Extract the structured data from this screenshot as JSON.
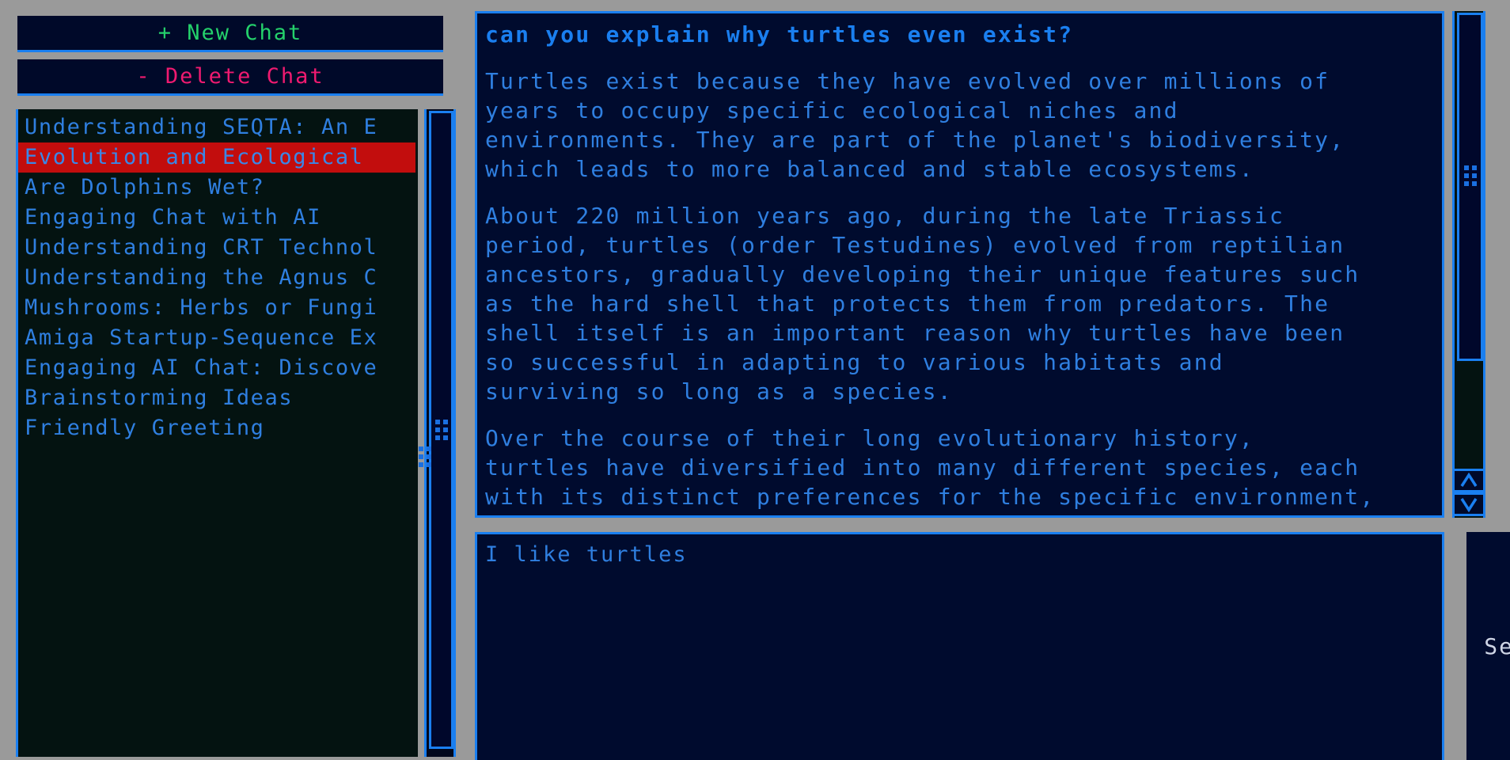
{
  "sidebar": {
    "new_chat_label": "+ New Chat",
    "delete_chat_label": "- Delete Chat",
    "chats": [
      {
        "title": "Understanding SEQTA: An E"
      },
      {
        "title": "Evolution and Ecological"
      },
      {
        "title": "Are Dolphins Wet?"
      },
      {
        "title": "Engaging Chat with AI"
      },
      {
        "title": "Understanding CRT Technol"
      },
      {
        "title": "Understanding the Agnus C"
      },
      {
        "title": "Mushrooms: Herbs or Fungi"
      },
      {
        "title": "Amiga Startup-Sequence Ex"
      },
      {
        "title": "Engaging AI Chat: Discove"
      },
      {
        "title": "Brainstorming Ideas"
      },
      {
        "title": "Friendly Greeting"
      }
    ],
    "selected_index": 1
  },
  "transcript": {
    "messages": [
      {
        "role": "user",
        "text": "can you explain why turtles even exist?"
      },
      {
        "role": "assistant",
        "text": "Turtles exist because they have evolved over millions of\nyears to occupy specific ecological niches and\nenvironments. They are part of the planet's biodiversity,\nwhich leads to more balanced and stable ecosystems."
      },
      {
        "role": "assistant",
        "text": "About 220 million years ago, during the late Triassic\nperiod, turtles (order Testudines) evolved from reptilian\nancestors, gradually developing their unique features such\nas the hard shell that protects them from predators. The\nshell itself is an important reason why turtles have been\nso successful in adapting to various habitats and\nsurviving so long as a species."
      },
      {
        "role": "assistant",
        "text": "Over the course of their long evolutionary history,\nturtles have diversified into many different species, each\nwith its distinct preferences for the specific environment,\n diet, and behavior. Some turtle species have found\nsuccess in terrestrial environments, while others thrive\nin freshwater or marine ecosystems."
      }
    ]
  },
  "composer": {
    "value": "I like turtles",
    "placeholder": "",
    "send_label": "Send"
  },
  "scrollbars": {
    "scroll_up_icon": "chevron-up-icon",
    "scroll_down_icon": "chevron-down-icon",
    "grip_icon": "grip-dots-icon"
  },
  "colors": {
    "desktop": "#9a9a9a",
    "panel_bg": "#000b2e",
    "list_bg": "#041311",
    "border": "#1a7ff0",
    "text": "#2f7fe0",
    "new_chat": "#24d16b",
    "delete_chat": "#f01a70",
    "selected_bg": "#c20d0d",
    "send_text": "#cfd6e6"
  }
}
